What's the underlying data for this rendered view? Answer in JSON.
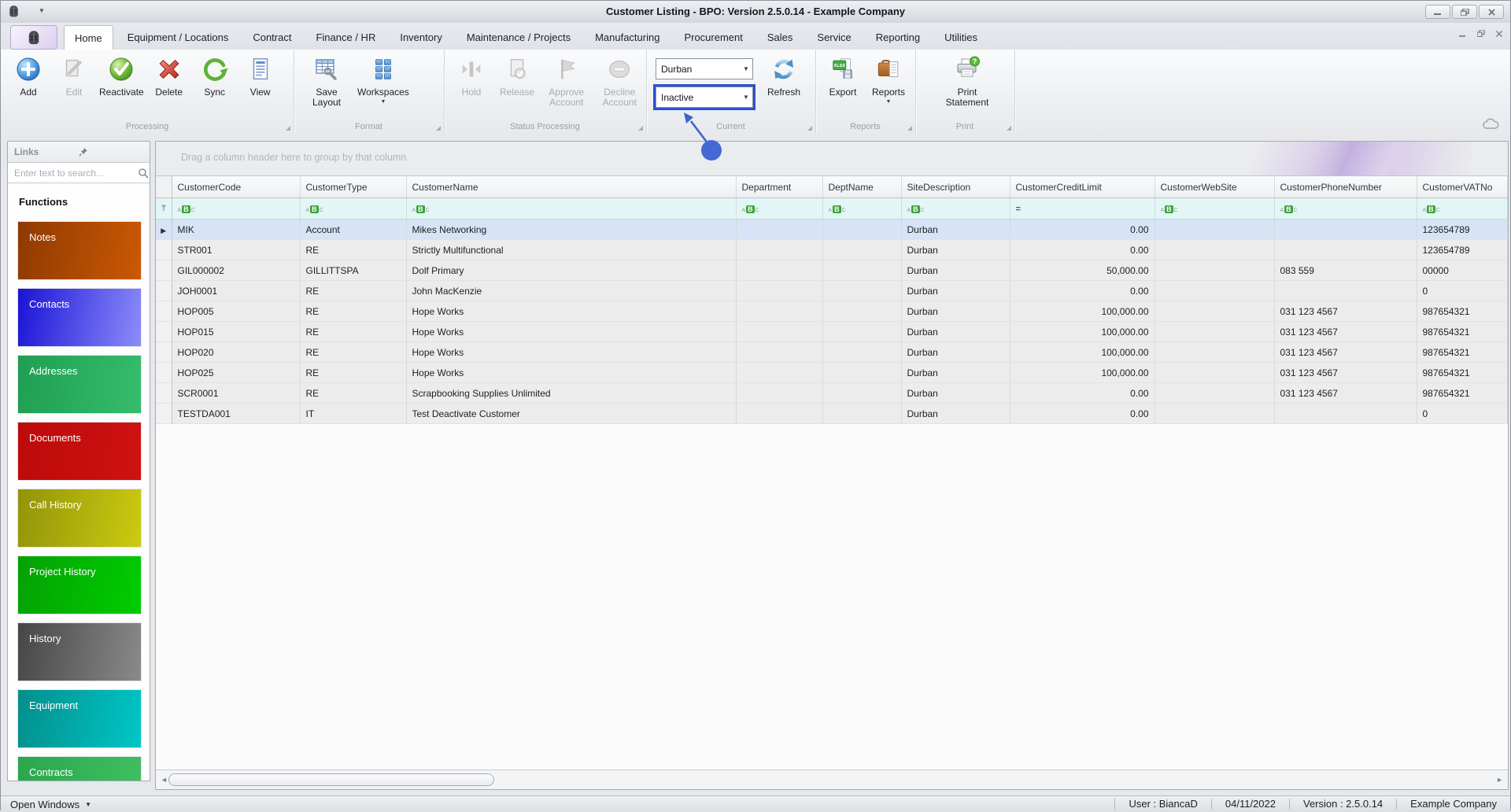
{
  "titlebar": {
    "title": "Customer Listing - BPO: Version 2.5.0.14 - Example Company"
  },
  "tabs": {
    "items": [
      "Home",
      "Equipment / Locations",
      "Contract",
      "Finance / HR",
      "Inventory",
      "Maintenance / Projects",
      "Manufacturing",
      "Procurement",
      "Sales",
      "Service",
      "Reporting",
      "Utilities"
    ],
    "active": "Home"
  },
  "ribbon": {
    "processing": {
      "label": "Processing",
      "add": "Add",
      "edit": "Edit",
      "reactivate": "Reactivate",
      "delete": "Delete",
      "sync": "Sync",
      "view": "View"
    },
    "format": {
      "label": "Format",
      "save_layout": "Save Layout",
      "workspaces": "Workspaces"
    },
    "status_processing": {
      "label": "Status Processing",
      "hold": "Hold",
      "release": "Release",
      "approve": "Approve Account",
      "decline": "Decline Account"
    },
    "current": {
      "label": "Current",
      "site": "Durban",
      "status": "Inactive",
      "refresh": "Refresh"
    },
    "reports": {
      "label": "Reports",
      "export": "Export",
      "reports": "Reports"
    },
    "print": {
      "label": "Print",
      "print_statement": "Print Statement"
    }
  },
  "sidebar": {
    "title": "Links",
    "search_placeholder": "Enter text to search...",
    "heading": "Functions",
    "functions": [
      {
        "label": "Notes",
        "from": "#8e3a02",
        "to": "#cb5803"
      },
      {
        "label": "Contacts",
        "from": "#1a13d6",
        "to": "#8c8cfa"
      },
      {
        "label": "Addresses",
        "from": "#1e9e52",
        "to": "#36bd6c"
      },
      {
        "label": "Documents",
        "from": "#bd0a0a",
        "to": "#ce1212"
      },
      {
        "label": "Call History",
        "from": "#93930a",
        "to": "#cbcb10"
      },
      {
        "label": "Project History",
        "from": "#04a104",
        "to": "#00cd00"
      },
      {
        "label": "History",
        "from": "#464646",
        "to": "#8a8a8a"
      },
      {
        "label": "Equipment",
        "from": "#038f8c",
        "to": "#00c6c6"
      },
      {
        "label": "Contracts",
        "from": "#2aa74d",
        "to": "#3fbf62"
      }
    ]
  },
  "grid": {
    "group_hint": "Drag a column header here to group by that column",
    "columns": [
      "CustomerCode",
      "CustomerType",
      "CustomerName",
      "Department",
      "DeptName",
      "SiteDescription",
      "CustomerCreditLimit",
      "CustomerWebSite",
      "CustomerPhoneNumber",
      "CustomerVATNo"
    ],
    "filter_types": [
      "abc",
      "abc",
      "abc",
      "abc",
      "abc",
      "abc",
      "equals",
      "abc",
      "abc",
      "abc"
    ],
    "rows": [
      {
        "selected": true,
        "cells": [
          "MIK",
          "Account",
          "Mikes Networking",
          "",
          "",
          "Durban",
          "0.00",
          "",
          "",
          "123654789"
        ]
      },
      {
        "selected": false,
        "cells": [
          "STR001",
          "RE",
          "Strictly Multifunctional",
          "",
          "",
          "Durban",
          "0.00",
          "",
          "",
          "123654789"
        ]
      },
      {
        "selected": false,
        "cells": [
          "GIL000002",
          "GILLITTSPA",
          "Dolf Primary",
          "",
          "",
          "Durban",
          "50,000.00",
          "",
          "083 559",
          "00000"
        ]
      },
      {
        "selected": false,
        "cells": [
          "JOH0001",
          "RE",
          "John MacKenzie",
          "",
          "",
          "Durban",
          "0.00",
          "",
          "",
          "0"
        ]
      },
      {
        "selected": false,
        "cells": [
          "HOP005",
          "RE",
          "Hope Works",
          "",
          "",
          "Durban",
          "100,000.00",
          "",
          "031 123 4567",
          "987654321"
        ]
      },
      {
        "selected": false,
        "cells": [
          "HOP015",
          "RE",
          "Hope Works",
          "",
          "",
          "Durban",
          "100,000.00",
          "",
          "031 123 4567",
          "987654321"
        ]
      },
      {
        "selected": false,
        "cells": [
          "HOP020",
          "RE",
          "Hope Works",
          "",
          "",
          "Durban",
          "100,000.00",
          "",
          "031 123 4567",
          "987654321"
        ]
      },
      {
        "selected": false,
        "cells": [
          "HOP025",
          "RE",
          "Hope Works",
          "",
          "",
          "Durban",
          "100,000.00",
          "",
          "031 123 4567",
          "987654321"
        ]
      },
      {
        "selected": false,
        "cells": [
          "SCR0001",
          "RE",
          "Scrapbooking Supplies Unlimited",
          "",
          "",
          "Durban",
          "0.00",
          "",
          "031 123 4567",
          "987654321"
        ]
      },
      {
        "selected": false,
        "cells": [
          "TESTDA001",
          "IT",
          "Test Deactivate Customer",
          "",
          "",
          "Durban",
          "0.00",
          "",
          "",
          "0"
        ]
      }
    ]
  },
  "statusbar": {
    "open_windows": "Open Windows",
    "user": "User : BiancaD",
    "date": "04/11/2022",
    "version": "Version : 2.5.0.14",
    "company": "Example Company"
  },
  "colors": {
    "annotation_blue": "#4468d4",
    "highlight_border": "#2b50cf",
    "selected_row": "#d7e4f6",
    "filter_row": "#e2f6f6"
  }
}
